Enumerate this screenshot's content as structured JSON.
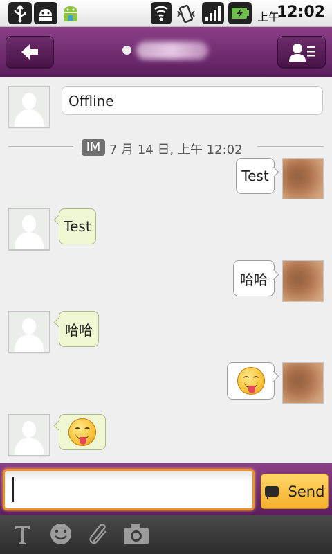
{
  "status_bar": {
    "ampm": "上午",
    "time": "12:02",
    "icons": [
      "usb-icon",
      "android-debug-icon",
      "android-icon",
      "wifi-icon",
      "vibrate-icon",
      "signal-icon",
      "battery-charging-icon"
    ]
  },
  "header": {
    "back_icon": "back-arrow-icon",
    "contact_icon": "contact-card-icon",
    "presence": "online-dot"
  },
  "chat": {
    "offline_notice": "Offline",
    "date_badge": "IM",
    "date_text": "7 月 14 日, 上午 12:02",
    "messages": [
      {
        "side": "out",
        "text": "Test"
      },
      {
        "side": "in",
        "text": "Test"
      },
      {
        "side": "out",
        "text": "哈哈"
      },
      {
        "side": "in",
        "text": "哈哈"
      },
      {
        "side": "out",
        "emoji": "tongue-out-emoji"
      },
      {
        "side": "in",
        "emoji": "tongue-out-emoji"
      }
    ]
  },
  "composer": {
    "value": "",
    "send_label": "Send"
  },
  "toolbar": {
    "items": [
      "text-format-icon",
      "smiley-icon",
      "attachment-icon",
      "camera-icon"
    ]
  },
  "colors": {
    "accent_purple": "#6b2a6a",
    "send_orange": "#f4b02b",
    "incoming_bubble": "#eef7d2"
  }
}
